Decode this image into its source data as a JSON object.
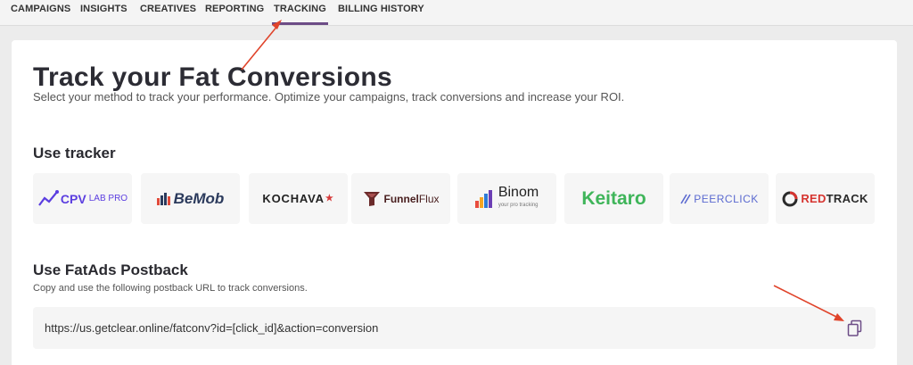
{
  "nav": {
    "tabs": [
      {
        "label": "CAMPAIGNS"
      },
      {
        "label": "INSIGHTS"
      },
      {
        "label": "CREATIVES"
      },
      {
        "label": "REPORTING"
      },
      {
        "label": "TRACKING"
      },
      {
        "label": "BILLING HISTORY"
      }
    ],
    "active_tab": "TRACKING"
  },
  "header": {
    "title": "Track your Fat Conversions",
    "subtitle": "Select your method to track your performance. Optimize your campaigns, track conversions and increase your ROI."
  },
  "tracker_section": {
    "heading": "Use tracker",
    "trackers": [
      {
        "name": "CPV LAB PRO",
        "main": "CPV",
        "sub": "LAB PRO",
        "color": "#5b3ee0"
      },
      {
        "name": "BeMob",
        "main": "BeMob",
        "color": "#2b3a5c"
      },
      {
        "name": "KOCHAVA",
        "main": "KOCHAVA",
        "color": "#222222"
      },
      {
        "name": "FunnelFlux",
        "main": "Funnel",
        "sub": "Flux",
        "color": "#4a2020"
      },
      {
        "name": "Binom",
        "main": "Binom",
        "sub": "your pro tracking",
        "color": "#222222"
      },
      {
        "name": "Keitaro",
        "main": "Keitaro",
        "color": "#3fb55a"
      },
      {
        "name": "PEERCLICK",
        "main": "PEERCLICK",
        "color": "#5b6ad0"
      },
      {
        "name": "REDTRACK",
        "main": "RED",
        "sub": "TRACK",
        "color": "#d6342f"
      }
    ]
  },
  "postback_section": {
    "heading": "Use FatAds Postback",
    "note": "Copy and use the following postback URL to track conversions.",
    "url": "https://us.getclear.online/fatconv?id=[click_id]&action=conversion"
  },
  "colors": {
    "accent": "#6c4c86",
    "annotation_arrow": "#e0442b"
  }
}
